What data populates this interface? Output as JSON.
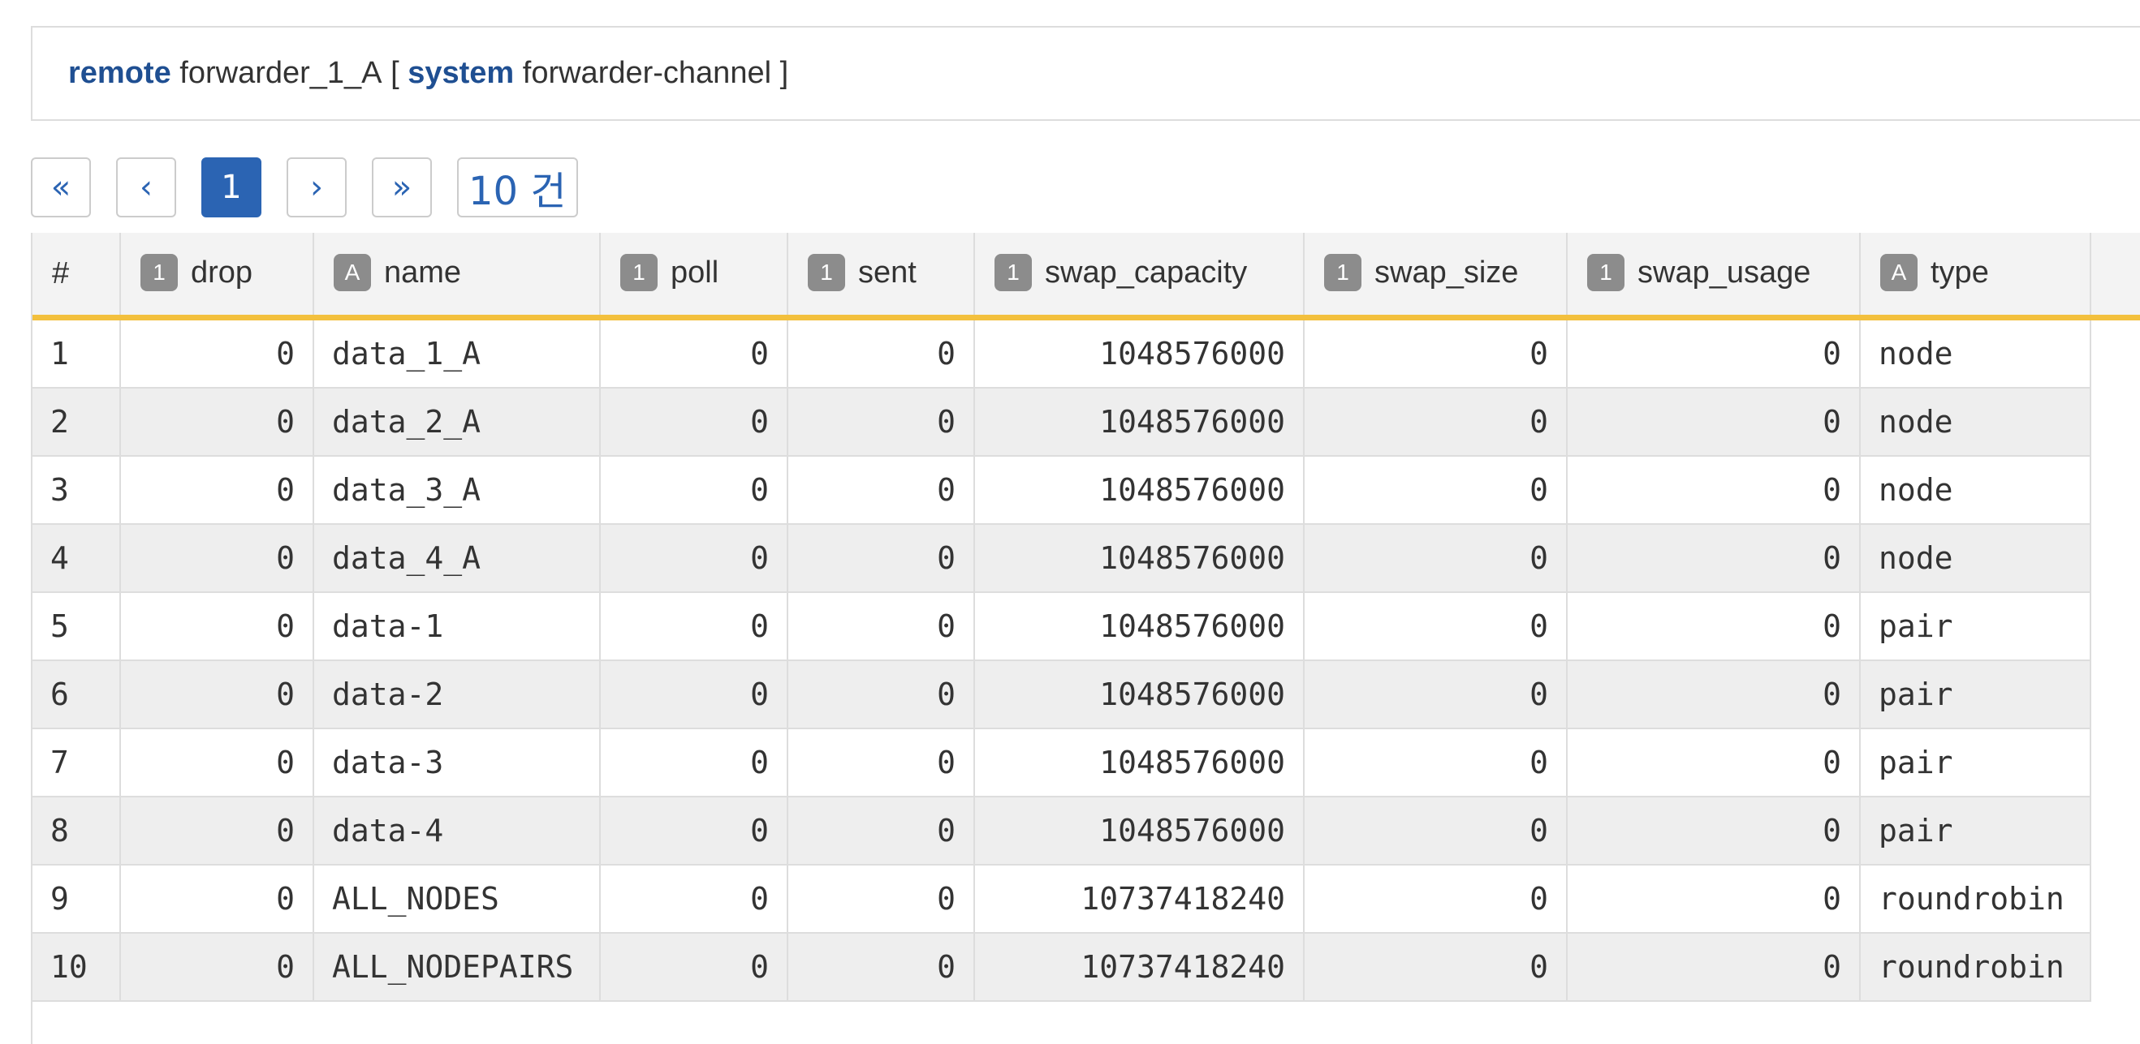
{
  "query": {
    "keyword_remote": "remote",
    "remote_name": "forwarder_1_A",
    "open_bracket": "[",
    "keyword_system": "system",
    "system_name": "forwarder-channel",
    "close_bracket": "]"
  },
  "pager": {
    "first": "«",
    "prev": "‹",
    "current": "1",
    "next": "›",
    "last": "»",
    "count": "10 건"
  },
  "table": {
    "columns": [
      {
        "key": "index",
        "label": "#",
        "type": ""
      },
      {
        "key": "drop",
        "label": "drop",
        "type": "1"
      },
      {
        "key": "name",
        "label": "name",
        "type": "A"
      },
      {
        "key": "poll",
        "label": "poll",
        "type": "1"
      },
      {
        "key": "sent",
        "label": "sent",
        "type": "1"
      },
      {
        "key": "swap_capacity",
        "label": "swap_capacity",
        "type": "1"
      },
      {
        "key": "swap_size",
        "label": "swap_size",
        "type": "1"
      },
      {
        "key": "swap_usage",
        "label": "swap_usage",
        "type": "1"
      },
      {
        "key": "type",
        "label": "type",
        "type": "A"
      }
    ],
    "rows": [
      [
        "1",
        "0",
        "data_1_A",
        "0",
        "0",
        "1048576000",
        "0",
        "0",
        "node"
      ],
      [
        "2",
        "0",
        "data_2_A",
        "0",
        "0",
        "1048576000",
        "0",
        "0",
        "node"
      ],
      [
        "3",
        "0",
        "data_3_A",
        "0",
        "0",
        "1048576000",
        "0",
        "0",
        "node"
      ],
      [
        "4",
        "0",
        "data_4_A",
        "0",
        "0",
        "1048576000",
        "0",
        "0",
        "node"
      ],
      [
        "5",
        "0",
        "data-1",
        "0",
        "0",
        "1048576000",
        "0",
        "0",
        "pair"
      ],
      [
        "6",
        "0",
        "data-2",
        "0",
        "0",
        "1048576000",
        "0",
        "0",
        "pair"
      ],
      [
        "7",
        "0",
        "data-3",
        "0",
        "0",
        "1048576000",
        "0",
        "0",
        "pair"
      ],
      [
        "8",
        "0",
        "data-4",
        "0",
        "0",
        "1048576000",
        "0",
        "0",
        "pair"
      ],
      [
        "9",
        "0",
        "ALL_NODES",
        "0",
        "0",
        "10737418240",
        "0",
        "0",
        "roundrobin"
      ],
      [
        "10",
        "0",
        "ALL_NODEPAIRS",
        "0",
        "0",
        "10737418240",
        "0",
        "0",
        "roundrobin"
      ]
    ]
  },
  "colors": {
    "keyword": "#1f4f92",
    "accent": "#2b64b3",
    "header_underline": "#f3c03d",
    "type_badge": "#8c8c8c"
  }
}
